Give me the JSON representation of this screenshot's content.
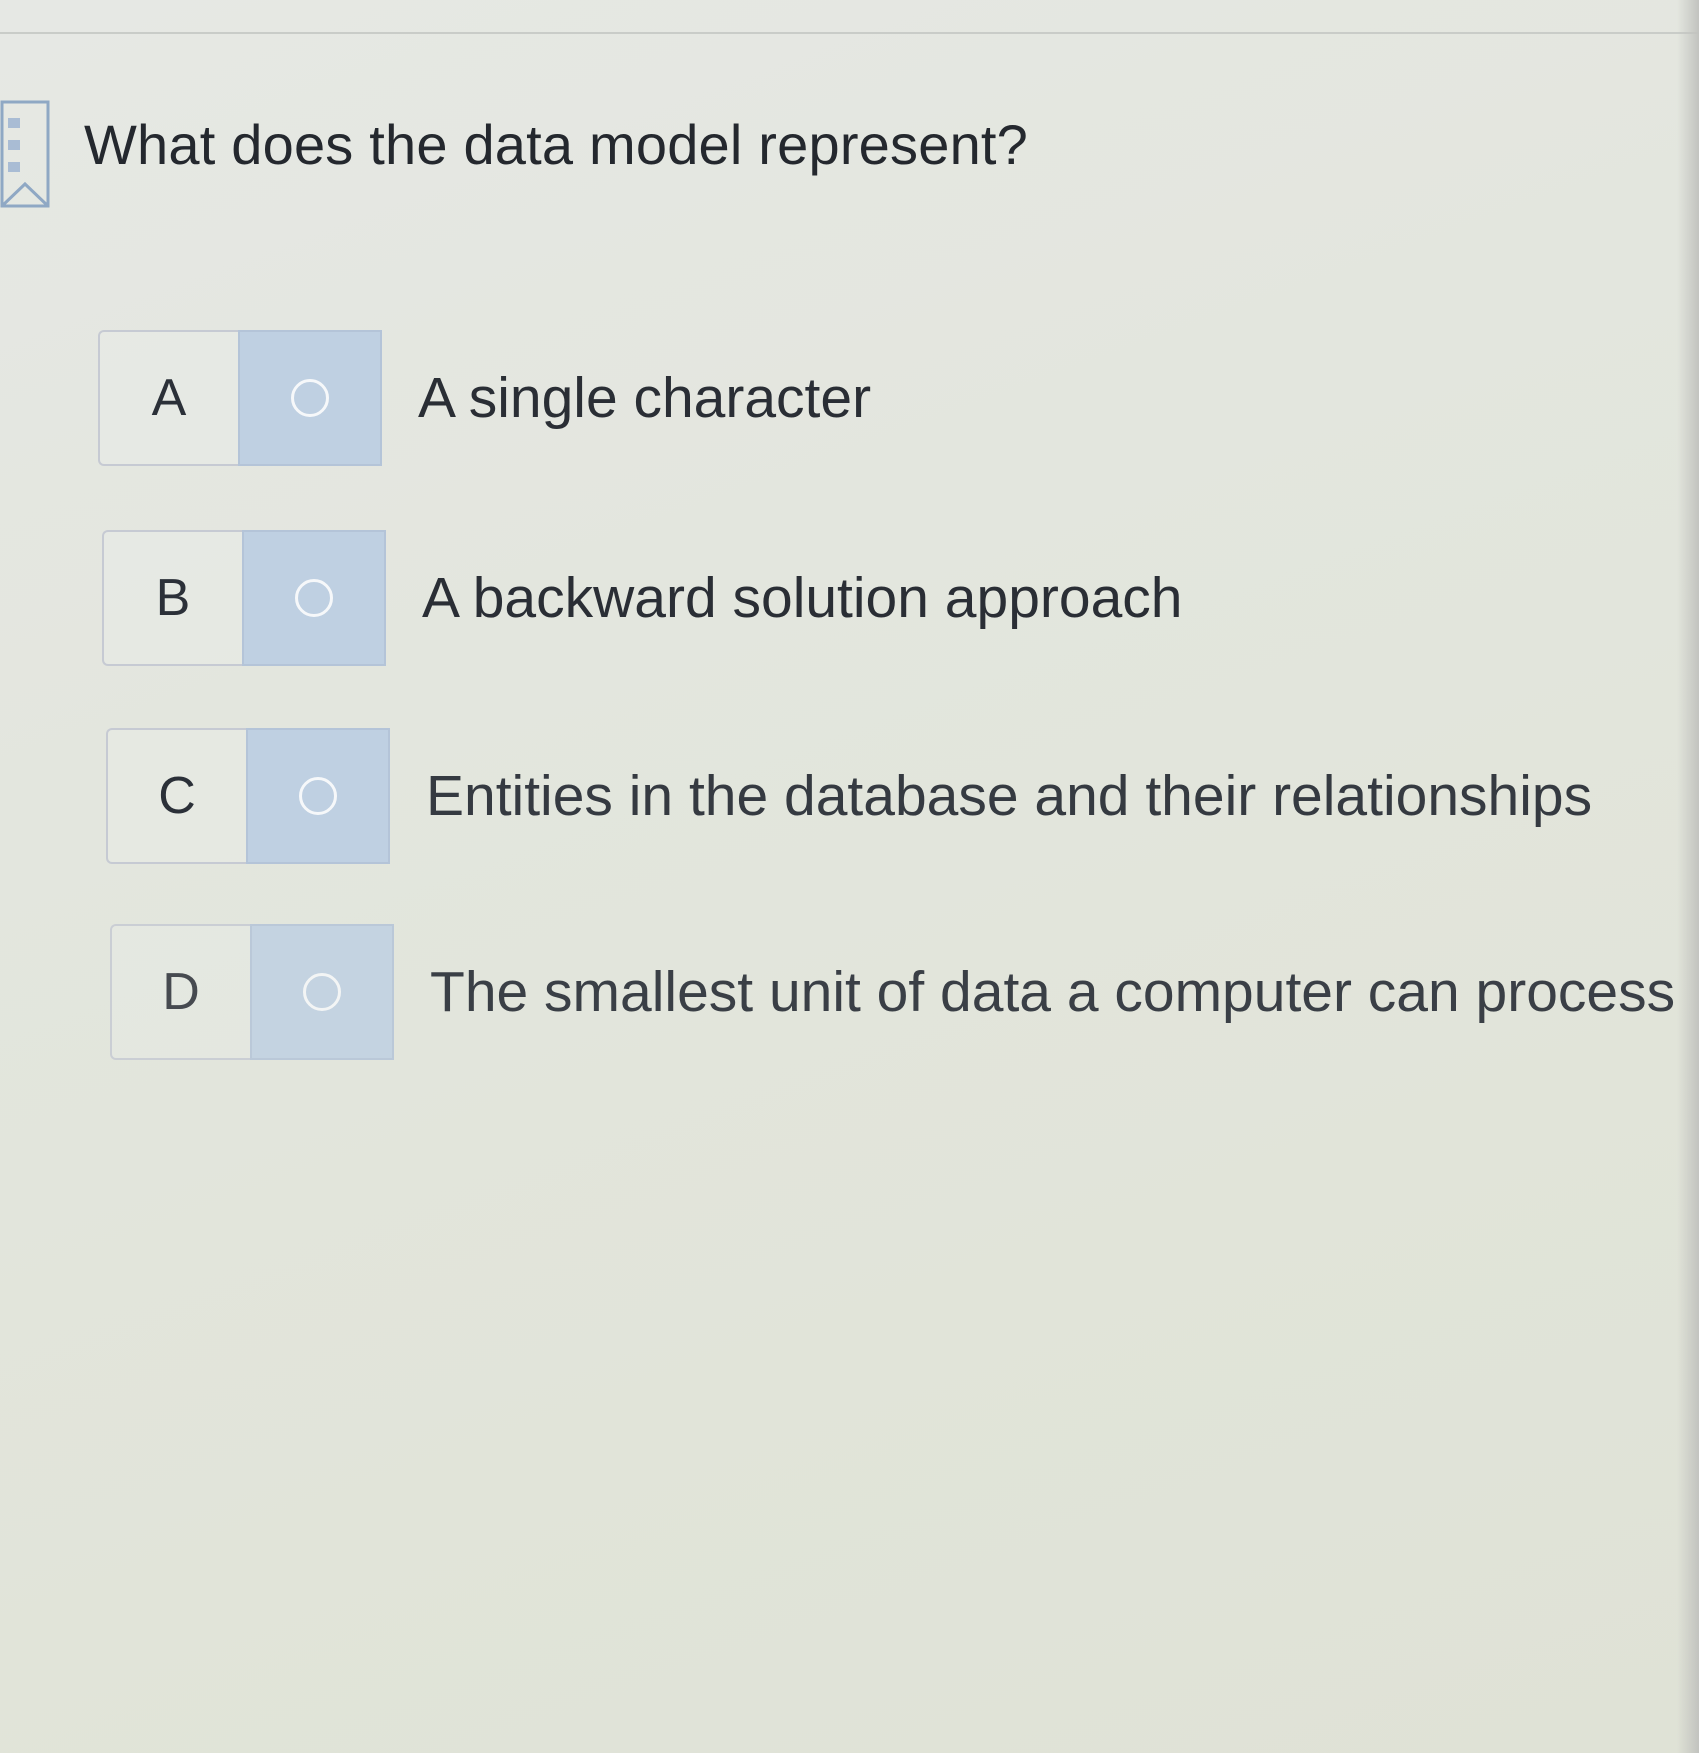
{
  "question": {
    "text": "What does the data model represent?"
  },
  "options": [
    {
      "letter": "A",
      "text": "A single character",
      "selected": false
    },
    {
      "letter": "B",
      "text": "A backward solution approach",
      "selected": false
    },
    {
      "letter": "C",
      "text": "Entities in the database and their relationships",
      "selected": false
    },
    {
      "letter": "D",
      "text": "The smallest unit of data a computer can process",
      "selected": false
    }
  ],
  "icons": {
    "bookmark": "bookmark-flag-icon",
    "radio": "radio-unchecked-icon"
  },
  "colors": {
    "radio_background": "#bfd0e2",
    "page_background": "#e3e6de",
    "text": "#262a30"
  }
}
